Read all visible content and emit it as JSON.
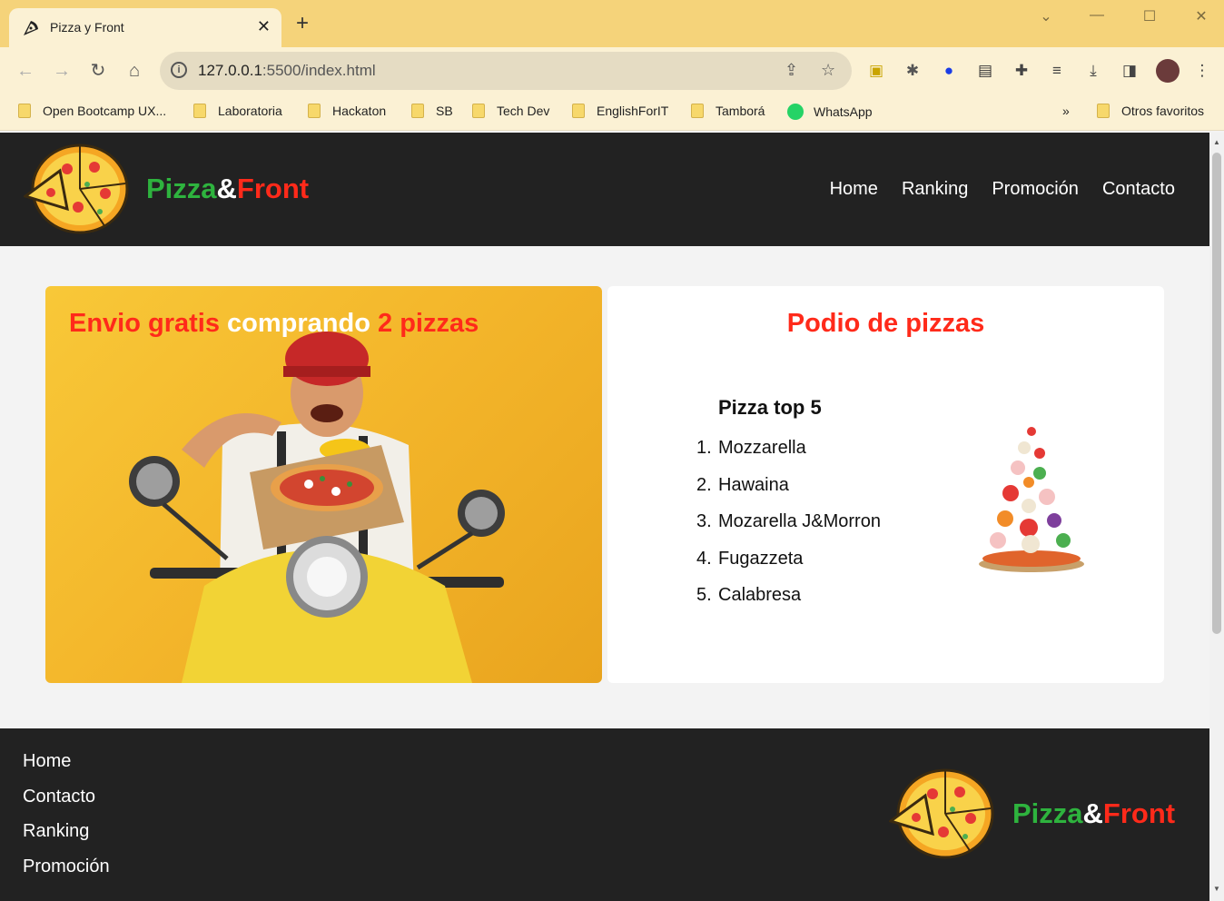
{
  "browser": {
    "tab_title": "Pizza y Front",
    "url_host": "127.0.0.1",
    "url_path": ":5500/index.html",
    "bookmarks": [
      "Open Bootcamp UX...",
      "Laboratoria",
      "Hackaton",
      "SB",
      "Tech Dev",
      "EnglishForIT",
      "Tamborá",
      "WhatsApp"
    ],
    "more_bookmarks": "»",
    "other_favorites": "Otros favoritos"
  },
  "header": {
    "brand_part1": "Pizza",
    "brand_amp": "&",
    "brand_part2": "Front",
    "nav": [
      "Home",
      "Ranking",
      "Promoción",
      "Contacto"
    ]
  },
  "promo": {
    "title_part1": "Envio gratis ",
    "title_part2": "comprando ",
    "title_part3": "2 pizzas"
  },
  "podium": {
    "title": "Podio de pizzas",
    "list_title": "Pizza top 5",
    "items": [
      "Mozzarella",
      "Hawaina",
      "Mozarella J&Morron",
      "Fugazzeta",
      "Calabresa"
    ]
  },
  "footer": {
    "links": [
      "Home",
      "Contacto",
      "Ranking",
      "Promoción"
    ],
    "brand_part1": "Pizza",
    "brand_amp": "&",
    "brand_part2": "Front"
  },
  "colors": {
    "chrome_tabbar": "#f5d37a",
    "chrome_toolbar": "#fbf1d4",
    "header_bg": "#222222",
    "brand_green": "#2eb33e",
    "brand_red": "#ff2a1a"
  }
}
